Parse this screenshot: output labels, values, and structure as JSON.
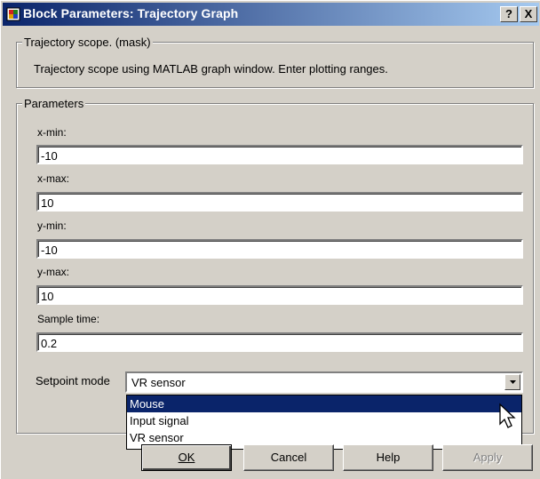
{
  "window": {
    "title": "Block Parameters: Trajectory Graph",
    "help_label": "?",
    "close_label": "X",
    "icon": "simulink-block-icon"
  },
  "description_group": {
    "legend": "Trajectory scope. (mask)",
    "text": "Trajectory scope using MATLAB graph window. Enter plotting ranges."
  },
  "parameters": {
    "legend": "Parameters",
    "x_min": {
      "label": "x-min:",
      "value": "-10"
    },
    "x_max": {
      "label": "x-max:",
      "value": "10"
    },
    "y_min": {
      "label": "y-min:",
      "value": "-10"
    },
    "y_max": {
      "label": "y-max:",
      "value": "10"
    },
    "sample_time": {
      "label": "Sample time:",
      "value": "0.2"
    },
    "setpoint_mode": {
      "label": "Setpoint mode",
      "value": "VR sensor",
      "options": [
        "Mouse",
        "Input signal",
        "VR sensor"
      ],
      "highlighted": "Mouse"
    }
  },
  "buttons": {
    "ok": "OK",
    "cancel": "Cancel",
    "help": "Help",
    "apply": "Apply"
  },
  "colors": {
    "title_start": "#0a246a",
    "title_end": "#a6caf0",
    "face": "#d4d0c8",
    "selection": "#0a246a"
  }
}
